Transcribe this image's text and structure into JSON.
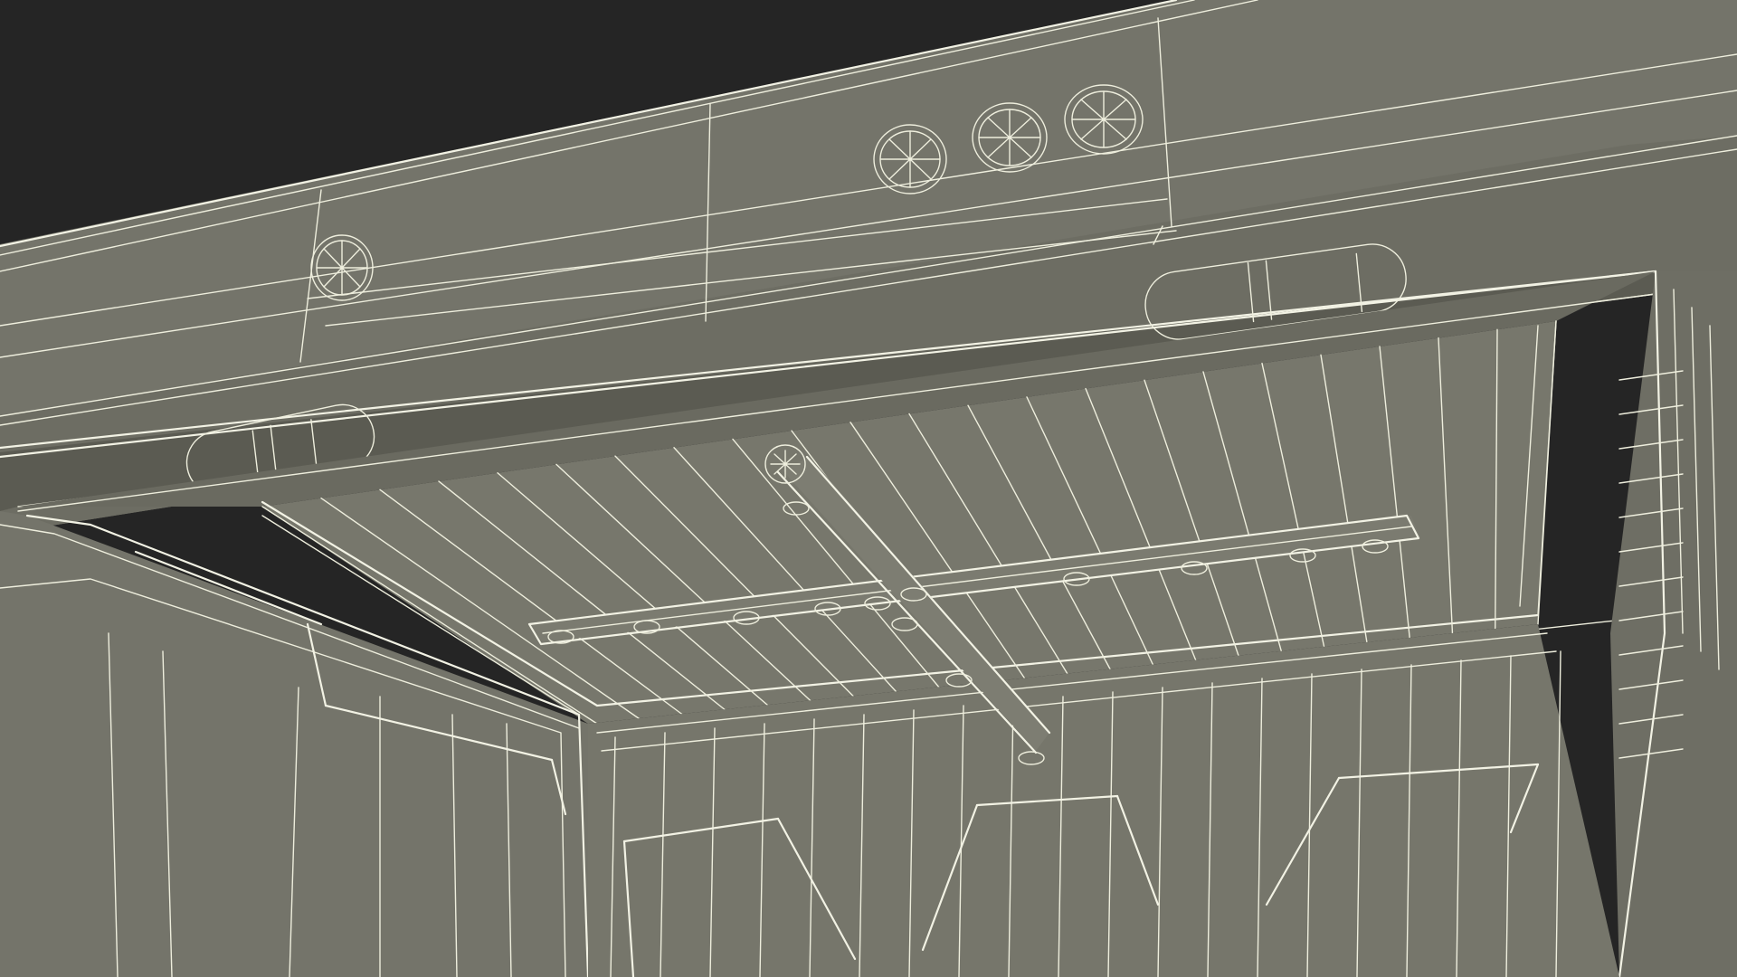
{
  "scene": {
    "subject": "dishwasher-interior-wireframe",
    "colors": {
      "background": "#252525",
      "surface": "#74746a",
      "surface_dark": "#616157",
      "surface_light": "#7d7d72",
      "wire": "#eeeedd"
    },
    "components": {
      "door_vents": 4,
      "hinge_cylinders": 2,
      "spray_arm_nozzles": 14
    }
  }
}
